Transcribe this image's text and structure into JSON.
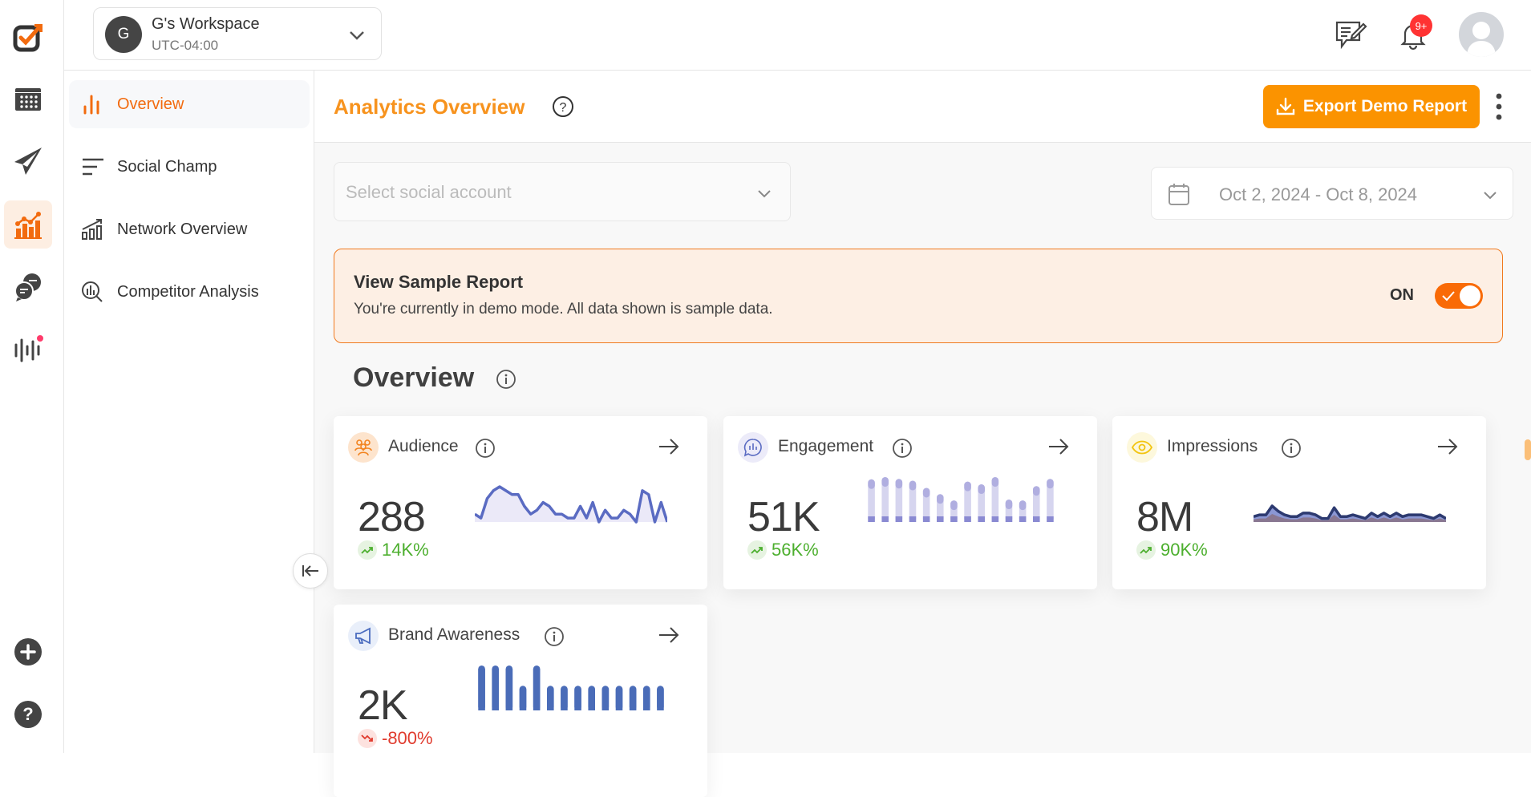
{
  "rail": {
    "items": [
      {
        "icon": "logo-check-icon"
      },
      {
        "icon": "calendar-icon"
      },
      {
        "icon": "paper-plane-icon"
      },
      {
        "icon": "analytics-icon",
        "active": true
      },
      {
        "icon": "chat-bubbles-icon"
      },
      {
        "icon": "audio-wave-icon",
        "dot_color": "#ff3b6b"
      }
    ],
    "bottom": [
      {
        "icon": "add-circle-icon"
      },
      {
        "icon": "help-circle-icon"
      }
    ]
  },
  "workspace": {
    "initial": "G",
    "name": "G's Workspace",
    "timezone": "UTC-04:00"
  },
  "topbar": {
    "notification_badge": "9+"
  },
  "subnav": {
    "items": [
      {
        "label": "Overview",
        "icon": "bar-chart-icon",
        "active": true
      },
      {
        "label": "Social Champ",
        "icon": "text-lines-icon"
      },
      {
        "label": "Network Overview",
        "icon": "growth-chart-icon"
      },
      {
        "label": "Competitor Analysis",
        "icon": "search-chart-icon"
      }
    ]
  },
  "header": {
    "title": "Analytics Overview",
    "export_label": "Export Demo Report"
  },
  "filters": {
    "account_placeholder": "Select social account",
    "date_range": "Oct 2, 2024 - Oct 8, 2024"
  },
  "banner": {
    "title": "View Sample Report",
    "subtitle": "You're currently in demo mode. All data shown is sample data.",
    "toggle_label": "ON",
    "toggle_on": true
  },
  "overview": {
    "title": "Overview",
    "cards": [
      {
        "label": "Audience",
        "value": "288",
        "change": "14K%",
        "trend": "up",
        "chart": "area",
        "series": [
          2,
          1,
          6,
          8,
          9,
          8,
          7,
          7,
          4,
          2,
          3,
          5,
          4,
          2,
          2,
          1,
          1,
          4,
          1,
          5,
          0,
          3,
          1,
          1,
          3,
          2,
          0,
          8,
          7,
          0,
          5,
          0
        ]
      },
      {
        "label": "Engagement",
        "value": "51K",
        "change": "56K%",
        "trend": "up",
        "chart": "bars",
        "series": [
          95,
          100,
          96,
          92,
          76,
          62,
          48,
          90,
          84,
          100,
          50,
          48,
          80,
          96
        ]
      },
      {
        "label": "Impressions",
        "value": "8M",
        "change": "90K%",
        "trend": "up",
        "chart": "dual-line",
        "series": [
          3,
          4,
          4,
          9,
          6,
          4,
          3,
          3,
          5,
          5,
          4,
          2,
          2,
          8,
          3,
          3,
          4,
          3,
          2,
          5,
          3,
          5,
          3,
          5,
          3,
          4,
          4,
          4,
          3,
          2,
          4,
          2
        ]
      },
      {
        "label": "Brand Awareness",
        "value": "2K",
        "change": "-800%",
        "trend": "down",
        "chart": "solid-bars",
        "series": [
          100,
          100,
          100,
          55,
          100,
          55,
          55,
          55,
          55,
          55,
          55,
          55,
          55,
          55
        ]
      }
    ]
  },
  "colors": {
    "accent": "#f7931e",
    "export_bg": "#fb9300",
    "toggle": "#f96a06",
    "positive": "#4caf2e",
    "negative": "#e03b2e",
    "spark": "#5a6bc2"
  }
}
